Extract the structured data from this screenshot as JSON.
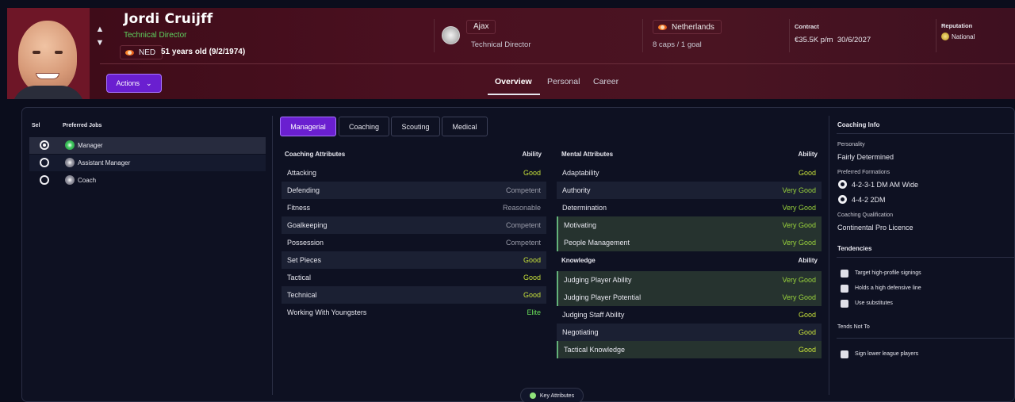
{
  "player": {
    "name": "Jordi Cruijff",
    "role": "Technical Director",
    "nationality_code": "NED",
    "age": "51 years old (9/2/1974)"
  },
  "club": {
    "name": "Ajax",
    "role": "Technical Director"
  },
  "country": {
    "name": "Netherlands",
    "caps": "8 caps / 1 goal"
  },
  "contract": {
    "label": "Contract",
    "wage": "€35.5K p/m",
    "expiry": "30/6/2027"
  },
  "reputation": {
    "label": "Reputation",
    "value": "National"
  },
  "actions_label": "Actions",
  "header_tabs": [
    "Overview",
    "Personal",
    "Career"
  ],
  "jobs": {
    "col_sel": "Sel",
    "col_jobs": "Preferred Jobs",
    "items": [
      "Manager",
      "Assistant Manager",
      "Coach"
    ]
  },
  "subtabs": [
    "Managerial",
    "Coaching",
    "Scouting",
    "Medical"
  ],
  "coaching_attributes": {
    "title": "Coaching Attributes",
    "ability_label": "Ability",
    "rows": [
      {
        "name": "Attacking",
        "value": "Good"
      },
      {
        "name": "Defending",
        "value": "Competent"
      },
      {
        "name": "Fitness",
        "value": "Reasonable"
      },
      {
        "name": "Goalkeeping",
        "value": "Competent"
      },
      {
        "name": "Possession",
        "value": "Competent"
      },
      {
        "name": "Set Pieces",
        "value": "Good"
      },
      {
        "name": "Tactical",
        "value": "Good"
      },
      {
        "name": "Technical",
        "value": "Good"
      },
      {
        "name": "Working With Youngsters",
        "value": "Elite"
      }
    ]
  },
  "mental_attributes": {
    "title": "Mental Attributes",
    "ability_label": "Ability",
    "rows": [
      {
        "name": "Adaptability",
        "value": "Good"
      },
      {
        "name": "Authority",
        "value": "Very Good"
      },
      {
        "name": "Determination",
        "value": "Very Good"
      },
      {
        "name": "Motivating",
        "value": "Very Good"
      },
      {
        "name": "People Management",
        "value": "Very Good"
      }
    ]
  },
  "knowledge": {
    "title": "Knowledge",
    "ability_label": "Ability",
    "rows": [
      {
        "name": "Judging Player Ability",
        "value": "Very Good"
      },
      {
        "name": "Judging Player Potential",
        "value": "Very Good"
      },
      {
        "name": "Judging Staff Ability",
        "value": "Good"
      },
      {
        "name": "Negotiating",
        "value": "Good"
      },
      {
        "name": "Tactical Knowledge",
        "value": "Good"
      }
    ]
  },
  "key_attributes_label": "Key Attributes",
  "coaching_info": {
    "title": "Coaching Info",
    "personality_label": "Personality",
    "personality": "Fairly Determined",
    "formations_label": "Preferred Formations",
    "formations": [
      "4-2-3-1 DM AM Wide",
      "4-4-2 2DM"
    ],
    "qualification_label": "Coaching Qualification",
    "qualification": "Continental Pro Licence",
    "tendencies_label": "Tendencies",
    "tendencies": [
      "Target high-profile signings",
      "Holds a high defensive line",
      "Use substitutes"
    ],
    "tends_not_to_label": "Tends Not To",
    "tends_not_to": [
      "Sign lower league players"
    ]
  },
  "colors": {
    "accent": "#6a1fd0",
    "header_bg": "#4a1020",
    "good": "#c8e23a",
    "very_good": "#9ad43c",
    "elite": "#6adf5a"
  }
}
